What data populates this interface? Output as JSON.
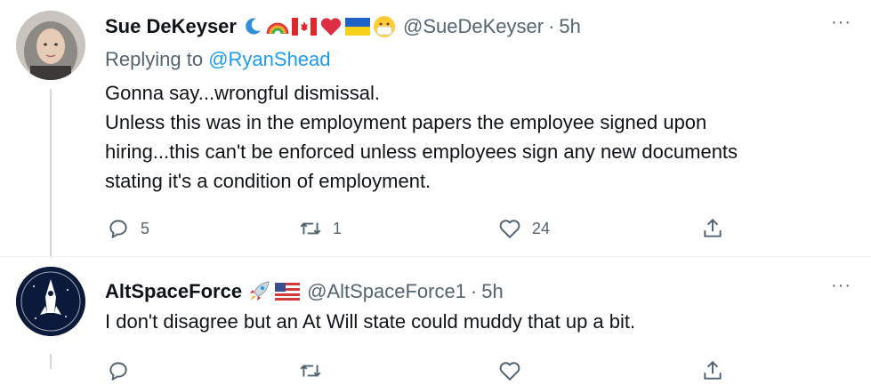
{
  "tweets": [
    {
      "name": "Sue DeKeyser",
      "emoji": [
        "moon-icon",
        "rainbow-icon",
        "canada-flag-icon",
        "heart-icon",
        "ukraine-flag-icon",
        "mask-face-icon"
      ],
      "handle": "@SueDeKeyser",
      "separator": "·",
      "time": "5h",
      "replying_prefix": "Replying to",
      "replying_to": "@RyanShead",
      "body_lines": [
        "Gonna say...wrongful dismissal.",
        "Unless this was in the employment papers the employee signed upon",
        "hiring...this can't be enforced unless employees sign any new documents",
        "stating it's a condition of employment."
      ],
      "replies": "5",
      "retweets": "1",
      "likes": "24",
      "more": "···"
    },
    {
      "name": "AltSpaceForce",
      "emoji": [
        "rocket-icon",
        "us-flag-icon"
      ],
      "handle": "@AltSpaceForce1",
      "separator": "·",
      "time": "5h",
      "body_lines": [
        "I don't disagree but an At Will state could muddy that up a bit."
      ],
      "more": "···"
    }
  ],
  "colors": {
    "text": "#0f1419",
    "secondary": "#536471",
    "link": "#1d9bf0",
    "thread_line": "#cfd9de"
  }
}
